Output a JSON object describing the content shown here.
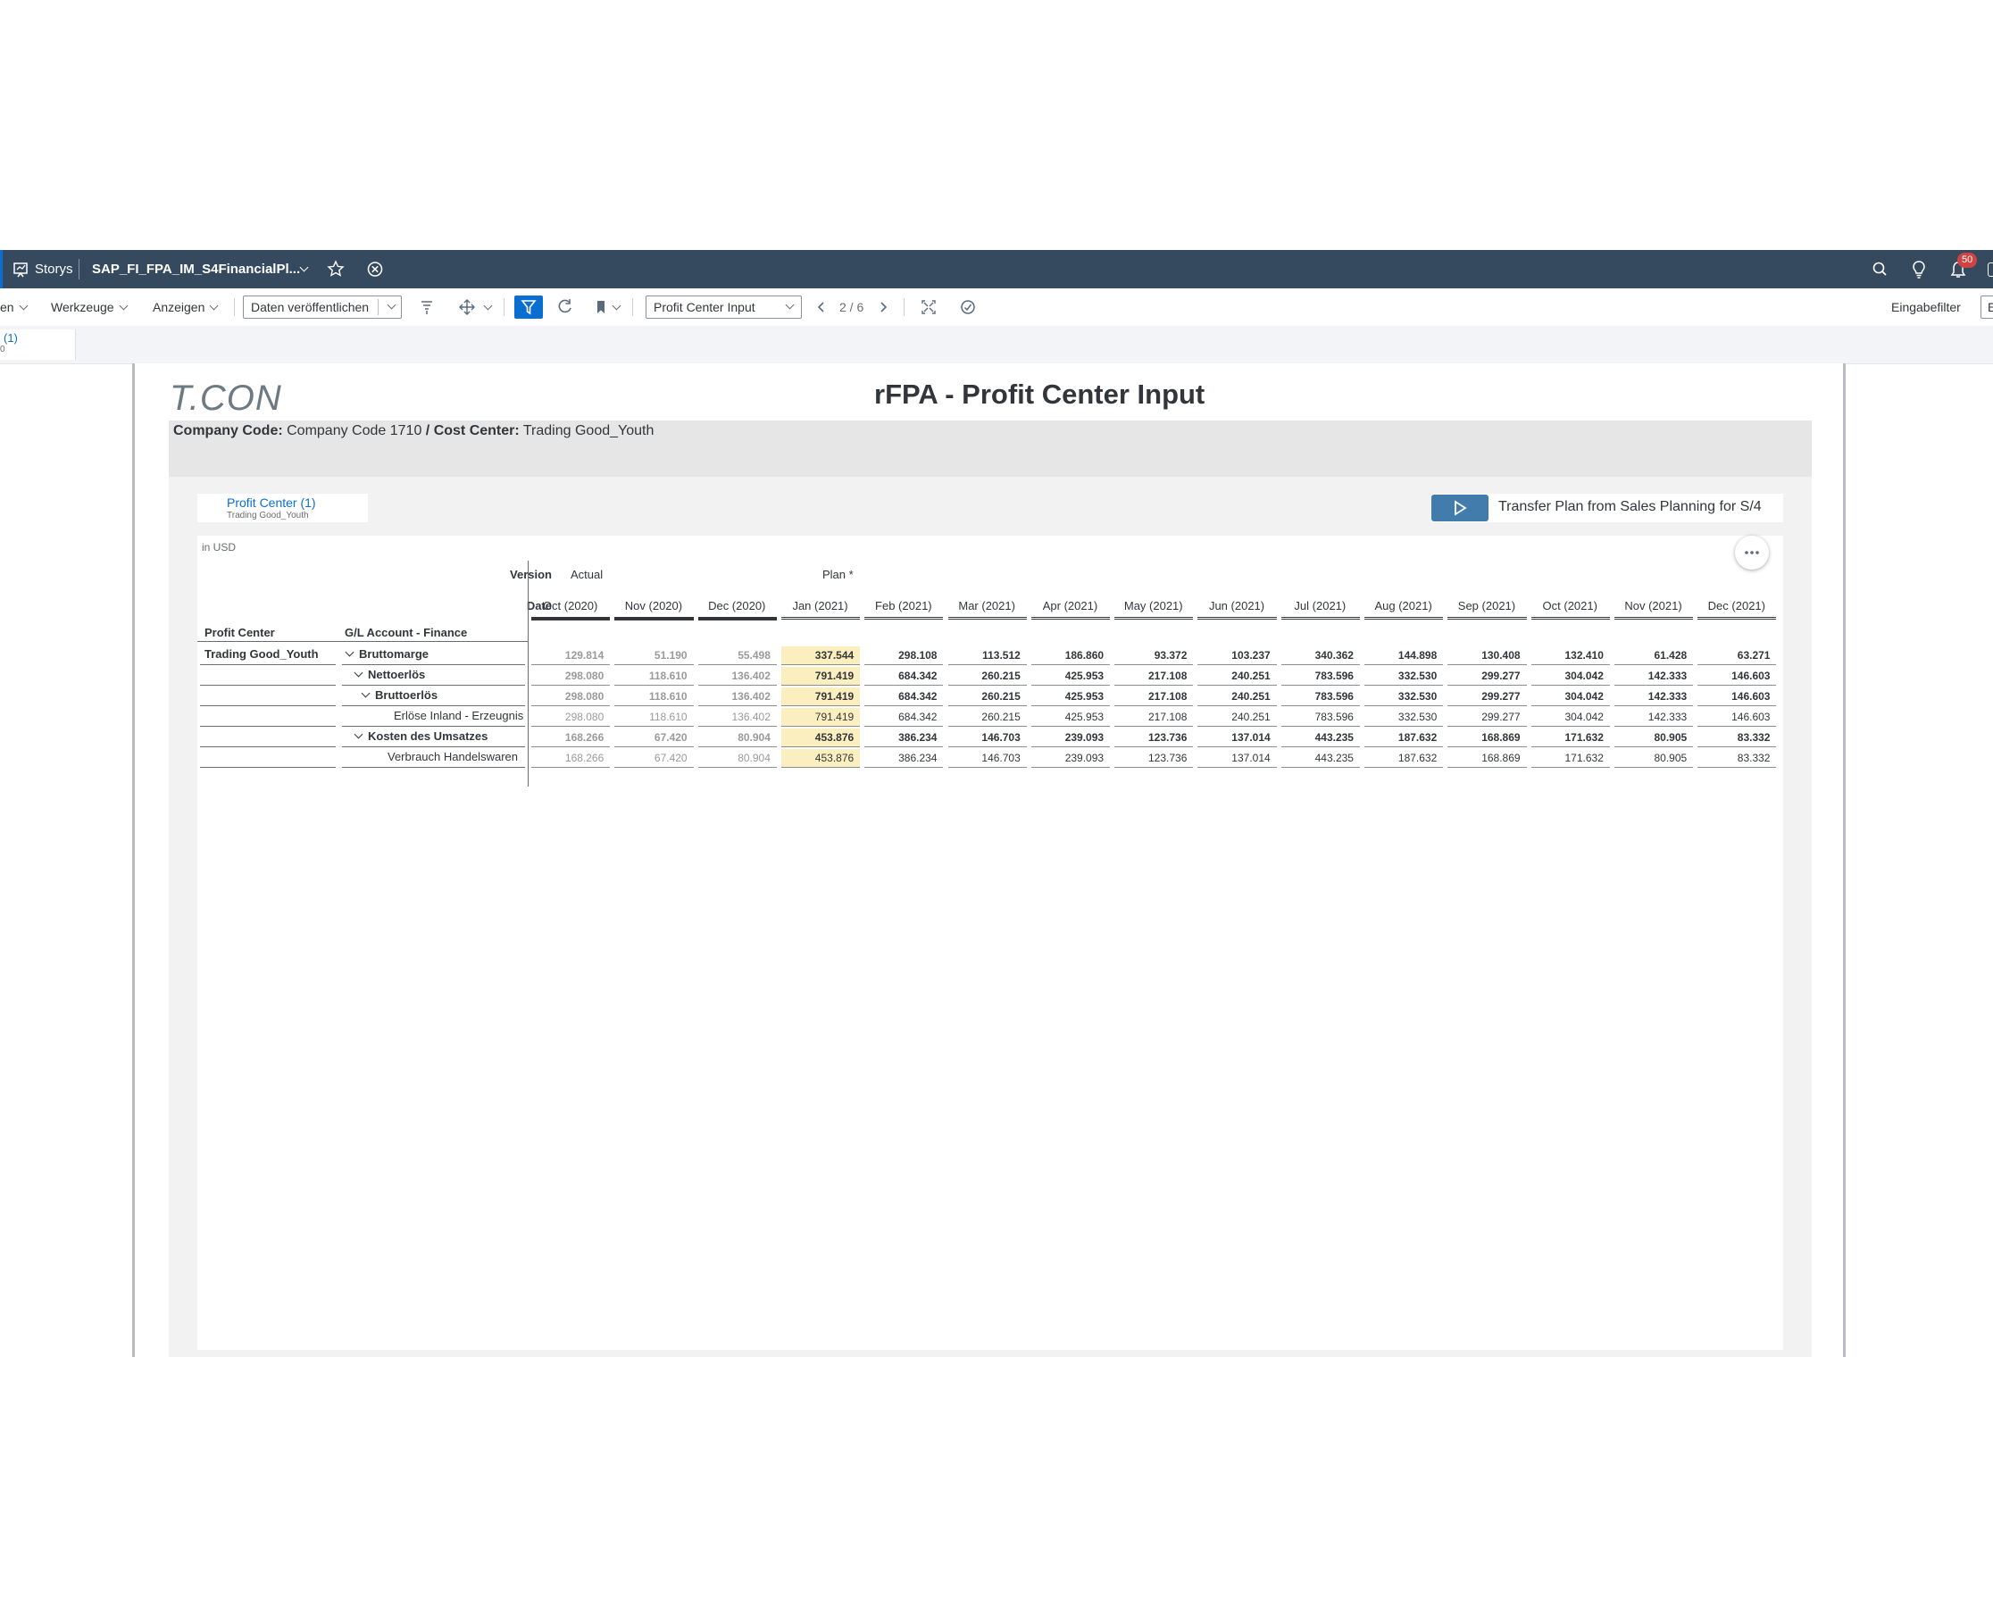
{
  "shell": {
    "storys_label": "Storys",
    "story_name": "SAP_FI_FPA_IM_S4FinancialPl...",
    "notification_count": "50"
  },
  "toolbar": {
    "menu_1": "en",
    "menu_werkzeuge": "Werkzeuge",
    "menu_anzeigen": "Anzeigen",
    "publish_label": "Daten veröffentlichen",
    "page_select_value": "Profit Center Input",
    "page_indicator": "2 / 6",
    "input_filter_label": "Eingabefilter",
    "cut_label": "E"
  },
  "tab": {
    "label": "(1)",
    "sub": "0"
  },
  "header": {
    "logo": "T.CON",
    "title": "rFPA - Profit Center Input",
    "company_code_label": "Company Code:",
    "company_code_value": "Company Code 1710",
    "separator": "/",
    "cost_center_label": "Cost Center:",
    "cost_center_value": "Trading Good_Youth"
  },
  "filter_chip": {
    "title": "Profit Center (1)",
    "value": "Trading Good_Youth"
  },
  "transfer_button": {
    "label": "Transfer Plan from Sales Planning for S/4"
  },
  "table": {
    "currency": "in USD",
    "version_label": "Version",
    "date_label": "Date",
    "version_actual": "Actual",
    "version_plan": "Plan *",
    "col_profit_center": "Profit Center",
    "col_gl_account": "G/L Account - Finance",
    "dates": [
      "Oct (2020)",
      "Nov (2020)",
      "Dec (2020)",
      "Jan (2021)",
      "Feb (2021)",
      "Mar (2021)",
      "Apr (2021)",
      "May (2021)",
      "Jun (2021)",
      "Jul (2021)",
      "Aug (2021)",
      "Sep (2021)",
      "Oct (2021)",
      "Nov (2021)",
      "Dec (2021)"
    ],
    "profit_center_value": "Trading Good_Youth",
    "rows": [
      {
        "label": "Bruttomarge",
        "level": 0,
        "expand": true,
        "bold": true,
        "values": [
          "129.814",
          "51.190",
          "55.498",
          "337.544",
          "298.108",
          "113.512",
          "186.860",
          "93.372",
          "103.237",
          "340.362",
          "144.898",
          "130.408",
          "132.410",
          "61.428",
          "63.271"
        ]
      },
      {
        "label": "Nettoerlös",
        "level": 1,
        "expand": true,
        "bold": true,
        "values": [
          "298.080",
          "118.610",
          "136.402",
          "791.419",
          "684.342",
          "260.215",
          "425.953",
          "217.108",
          "240.251",
          "783.596",
          "332.530",
          "299.277",
          "304.042",
          "142.333",
          "146.603"
        ]
      },
      {
        "label": "Bruttoerlös",
        "level": 2,
        "expand": true,
        "bold": true,
        "values": [
          "298.080",
          "118.610",
          "136.402",
          "791.419",
          "684.342",
          "260.215",
          "425.953",
          "217.108",
          "240.251",
          "783.596",
          "332.530",
          "299.277",
          "304.042",
          "142.333",
          "146.603"
        ]
      },
      {
        "label": "Erlöse Inland - Erzeugnis",
        "level": 3,
        "expand": false,
        "bold": false,
        "values": [
          "298.080",
          "118.610",
          "136.402",
          "791.419",
          "684.342",
          "260.215",
          "425.953",
          "217.108",
          "240.251",
          "783.596",
          "332.530",
          "299.277",
          "304.042",
          "142.333",
          "146.603"
        ]
      },
      {
        "label": "Kosten des Umsatzes",
        "level": 1,
        "expand": true,
        "bold": true,
        "values": [
          "168.266",
          "67.420",
          "80.904",
          "453.876",
          "386.234",
          "146.703",
          "239.093",
          "123.736",
          "137.014",
          "443.235",
          "187.632",
          "168.869",
          "171.632",
          "80.905",
          "83.332"
        ]
      },
      {
        "label": "Verbrauch Handelswaren",
        "level": 2,
        "expand": false,
        "bold": false,
        "values": [
          "168.266",
          "67.420",
          "80.904",
          "453.876",
          "386.234",
          "146.703",
          "239.093",
          "123.736",
          "137.014",
          "443.235",
          "187.632",
          "168.869",
          "171.632",
          "80.905",
          "83.332"
        ]
      }
    ]
  }
}
